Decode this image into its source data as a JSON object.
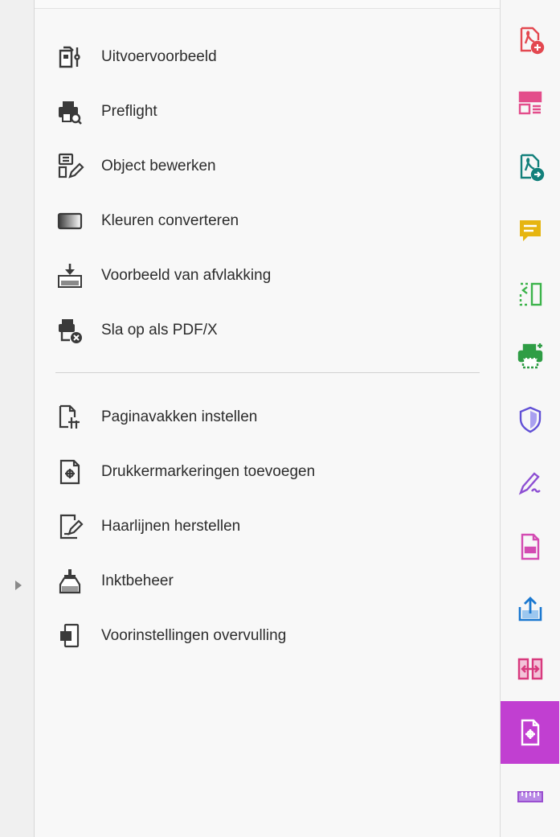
{
  "tools_group_1": [
    {
      "label": "Uitvoervoorbeeld",
      "icon": "output-preview-icon"
    },
    {
      "label": "Preflight",
      "icon": "preflight-icon"
    },
    {
      "label": "Object bewerken",
      "icon": "edit-object-icon"
    },
    {
      "label": "Kleuren converteren",
      "icon": "convert-colors-icon"
    },
    {
      "label": "Voorbeeld van afvlakking",
      "icon": "flattener-preview-icon"
    },
    {
      "label": "Sla op als PDF/X",
      "icon": "save-as-pdfx-icon"
    }
  ],
  "tools_group_2": [
    {
      "label": "Paginavakken instellen",
      "icon": "set-page-boxes-icon"
    },
    {
      "label": "Drukkermarkeringen toevoegen",
      "icon": "add-printer-marks-icon"
    },
    {
      "label": "Haarlijnen herstellen",
      "icon": "fix-hairlines-icon"
    },
    {
      "label": "Inktbeheer",
      "icon": "ink-manager-icon"
    },
    {
      "label": "Voorinstellingen overvulling",
      "icon": "trap-presets-icon"
    }
  ],
  "rail_icons": [
    {
      "icon": "create-pdf-icon",
      "color": "#e34850"
    },
    {
      "icon": "organize-pages-icon",
      "color": "#e34d8b"
    },
    {
      "icon": "export-pdf-icon",
      "color": "#12807b"
    },
    {
      "icon": "comment-icon",
      "color": "#e6b511"
    },
    {
      "icon": "scan-ocr-icon",
      "color": "#3bb34a"
    },
    {
      "icon": "print-production-icon",
      "color": "#2f9d45"
    },
    {
      "icon": "protect-icon",
      "color": "#6150d6"
    },
    {
      "icon": "fill-sign-icon",
      "color": "#8d4fd3"
    },
    {
      "icon": "redact-icon",
      "color": "#d34bb2"
    },
    {
      "icon": "share-icon",
      "color": "#1b78d0"
    },
    {
      "icon": "compare-files-icon",
      "color": "#d83a7e"
    },
    {
      "icon": "print-production-active-icon",
      "color": "#c13fd1"
    },
    {
      "icon": "measure-icon",
      "color": "#9a4fd0"
    }
  ],
  "colors": {
    "accent": "#c13fd1",
    "text": "#2c2c2c",
    "icon": "#3a3a3a"
  }
}
